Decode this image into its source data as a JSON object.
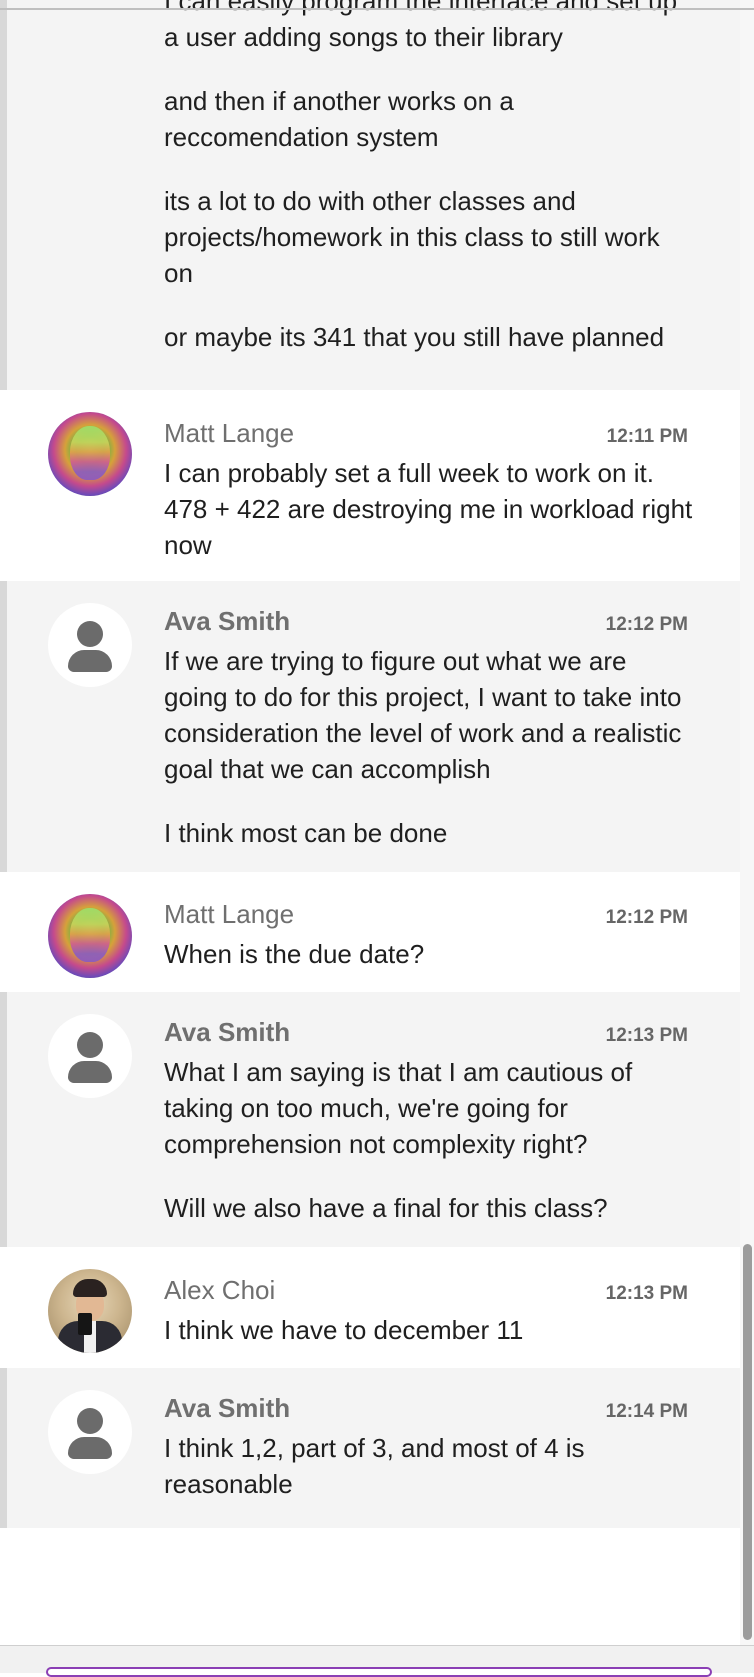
{
  "messages": [
    {
      "author": "",
      "time": "",
      "avatar": "",
      "paragraphs": [
        "I can easily program the interface and set up a user adding songs to their library",
        "and then if another works on a reccomendation system",
        "its a lot to do with other classes and projects/homework in this class to still work on",
        "or maybe its 341 that you still have planned"
      ]
    },
    {
      "author": "Matt Lange",
      "time": "12:11 PM",
      "avatar": "photo",
      "paragraphs": [
        "I can probably set a full week to work on it. 478 + 422 are destroying me in workload right now"
      ]
    },
    {
      "author": "Ava Smith",
      "time": "12:12 PM",
      "avatar": "person-icon",
      "paragraphs": [
        "If we are trying to figure out what we are going to do for this project, I want to take into consideration the level of work and a realistic goal that we can accomplish",
        "I think most can be done"
      ]
    },
    {
      "author": "Matt Lange",
      "time": "12:12 PM",
      "avatar": "photo",
      "paragraphs": [
        "When is the due date?"
      ]
    },
    {
      "author": "Ava Smith",
      "time": "12:13 PM",
      "avatar": "person-icon",
      "paragraphs": [
        "What I am saying is that I am cautious of taking on too much, we're going for comprehension not complexity right?",
        "Will we also have a final for this class?"
      ]
    },
    {
      "author": "Alex Choi",
      "time": "12:13 PM",
      "avatar": "photo",
      "paragraphs": [
        "I think we have to december 11"
      ]
    },
    {
      "author": "Ava Smith",
      "time": "12:14 PM",
      "avatar": "person-icon",
      "paragraphs": [
        "I think 1,2, part of 3, and most of 4 is reasonable"
      ]
    }
  ],
  "colors": {
    "self_background": "#f4f4f4",
    "other_background": "#ffffff",
    "compose_accent": "#8b3fb5"
  }
}
